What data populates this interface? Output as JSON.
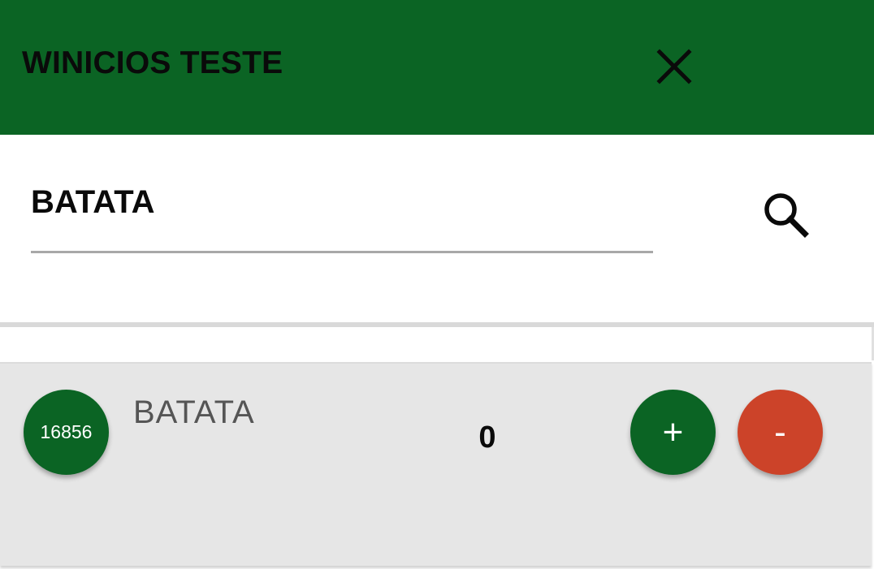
{
  "header": {
    "title": "WINICIOS TESTE",
    "close_icon": "close-icon"
  },
  "search": {
    "value": "BATATA",
    "search_icon": "search-icon"
  },
  "items": [
    {
      "code": "16856",
      "name": "BATATA",
      "quantity": "0",
      "plus_label": "+",
      "minus_label": "-"
    }
  ],
  "colors": {
    "primary": "#0b6424",
    "danger": "#cc4329",
    "item_background": "#e6e6e6"
  }
}
